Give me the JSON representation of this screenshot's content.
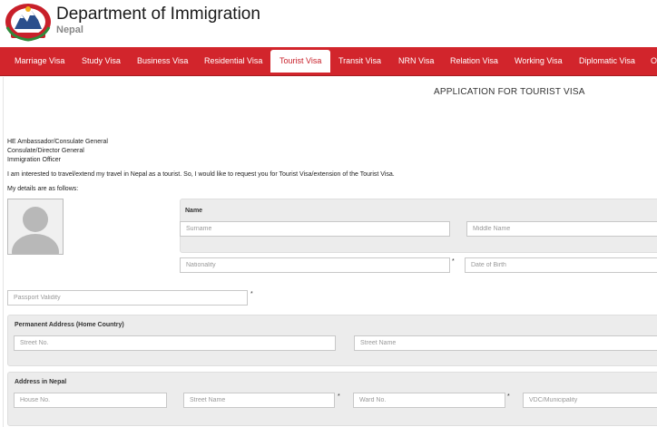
{
  "header": {
    "title": "Department of Immigration",
    "subtitle": "Nepal"
  },
  "nav": {
    "items": [
      {
        "label": "Marriage Visa"
      },
      {
        "label": "Study Visa"
      },
      {
        "label": "Business Visa"
      },
      {
        "label": "Residential Visa"
      },
      {
        "label": "Tourist Visa"
      },
      {
        "label": "Transit Visa"
      },
      {
        "label": "NRN Visa"
      },
      {
        "label": "Relation Visa"
      },
      {
        "label": "Working Visa"
      },
      {
        "label": "Diplomatic Visa"
      },
      {
        "label": "O"
      }
    ],
    "active_label": "Tourist Visa"
  },
  "form": {
    "title": "APPLICATION FOR TOURIST VISA",
    "addressee_lines": [
      "HE Ambassador/Consulate General",
      "Consulate/Director General",
      "Immigration Officer"
    ],
    "intro": "I am interested to travel/extend my travel in Nepal as a tourist. So, I would like to request you for Tourist Visa/extension of the Tourist Visa.",
    "details_label": "My details are as follows:",
    "name_section": {
      "label": "Name",
      "surname_placeholder": "Surname",
      "middle_name_placeholder": "Middle Name"
    },
    "nationality_placeholder": "Nationality",
    "date_of_birth_placeholder": "Date of Birth",
    "passport_validity_placeholder": "Passport Validity",
    "required_mark": "*",
    "permanent_address": {
      "label": "Permanent Address (Home Country)",
      "street_no_placeholder": "Street No.",
      "street_name_placeholder": "Street Name"
    },
    "nepal_address": {
      "label": "Address in Nepal",
      "house_no_placeholder": "House No.",
      "street_name_placeholder": "Street Name",
      "ward_no_placeholder": "Ward No.",
      "vdc_placeholder": "VDC/Municipality"
    }
  },
  "colors": {
    "nav_red": "#d2252c",
    "panel_gray": "#ececec"
  }
}
